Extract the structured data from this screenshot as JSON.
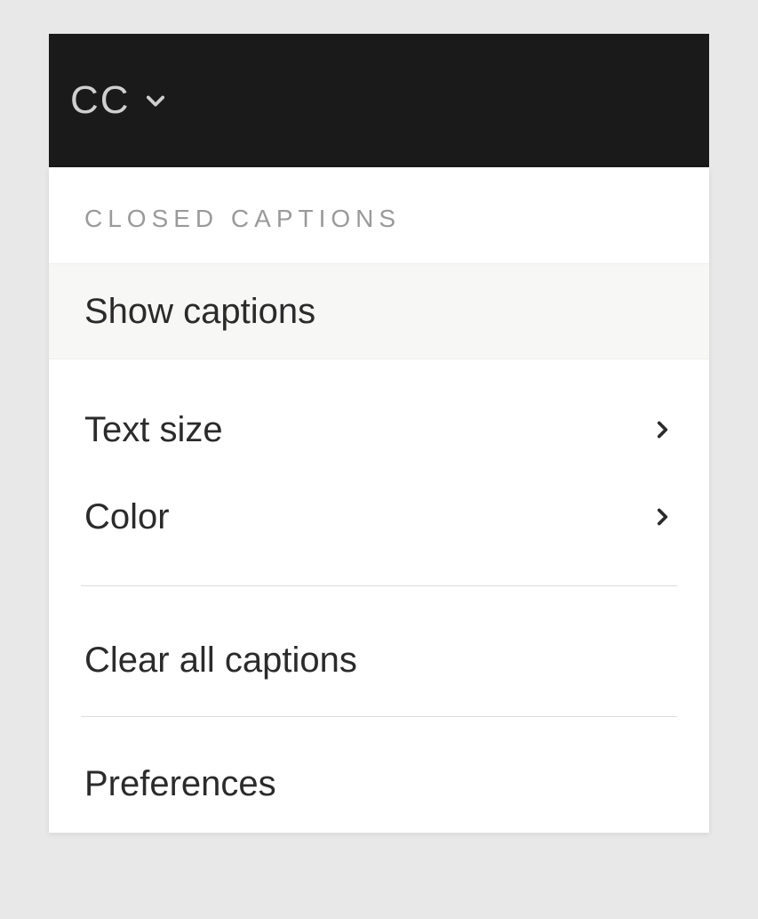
{
  "toolbar": {
    "cc_label": "CC"
  },
  "dropdown": {
    "header": "CLOSED CAPTIONS",
    "items": {
      "show_captions": "Show captions",
      "text_size": "Text size",
      "color": "Color",
      "clear_all": "Clear all captions",
      "preferences": "Preferences"
    }
  }
}
